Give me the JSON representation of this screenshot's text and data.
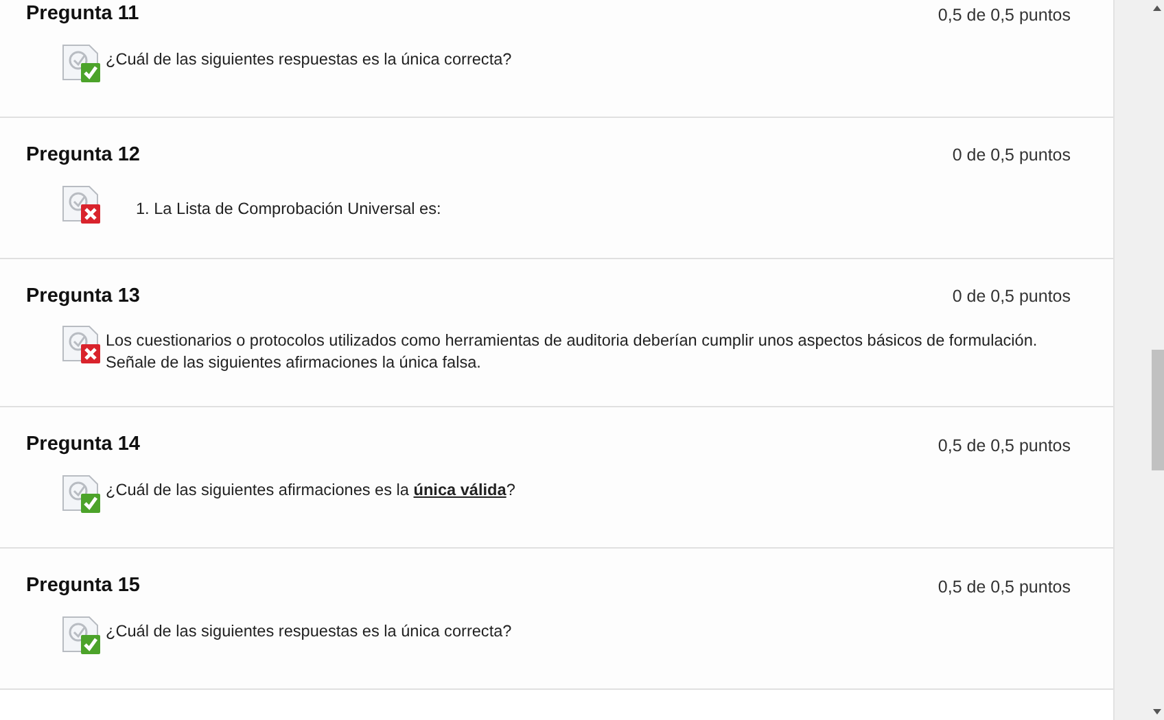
{
  "questions": [
    {
      "title": "Pregunta 11",
      "score": "0,5 de 0,5 puntos",
      "kind": "correct",
      "text": "¿Cuál de las siguientes respuestas es la única correcta?"
    },
    {
      "title": "Pregunta 12",
      "score": "0 de 0,5 puntos",
      "kind": "incorrect",
      "indented": true,
      "text": "1. La Lista de Comprobación Universal es:"
    },
    {
      "title": "Pregunta 13",
      "score": "0 de 0,5 puntos",
      "kind": "incorrect",
      "text": "Los cuestionarios o protocolos utilizados como herramientas de auditoria deberían cumplir unos aspectos básicos de formulación. Señale de las siguientes afirmaciones la única falsa."
    },
    {
      "title": "Pregunta 14",
      "score": "0,5 de 0,5 puntos",
      "kind": "correct",
      "text": "¿Cuál de las siguientes afirmaciones es la **única válida**?"
    },
    {
      "title": "Pregunta 15",
      "score": "0,5 de 0,5 puntos",
      "kind": "correct",
      "text": "¿Cuál de las siguientes respuestas es la única correcta?"
    }
  ]
}
